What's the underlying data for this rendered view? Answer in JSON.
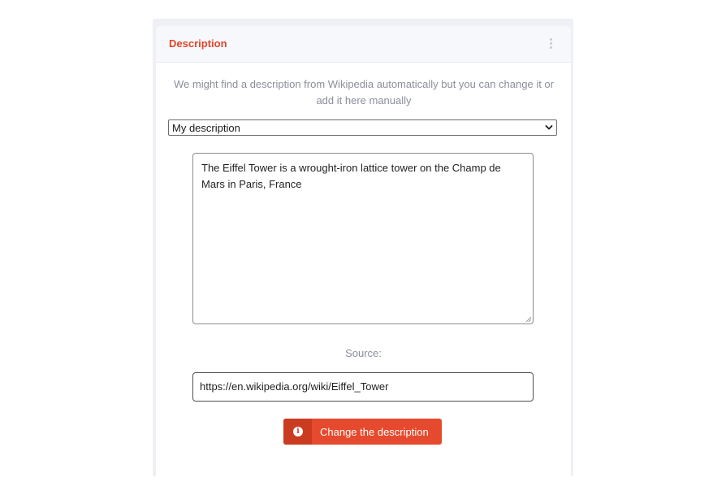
{
  "card": {
    "title": "Description",
    "intro": "We might find a description from Wikipedia automatically but you can change it or add it here manually"
  },
  "description_select": {
    "selected": "My description"
  },
  "description_text": "The Eiffel Tower is a wrought-iron lattice tower on the Champ de Mars in Paris, France",
  "source": {
    "label": "Source:",
    "value": "https://en.wikipedia.org/wiki/Eiffel_Tower"
  },
  "action_button": {
    "label": "Change the description",
    "icon": "info-icon"
  },
  "colors": {
    "accent": "#e3452a",
    "button": "#e64a2e",
    "button_icon_bg": "#c93c22",
    "muted_text": "#8a8f9c"
  }
}
